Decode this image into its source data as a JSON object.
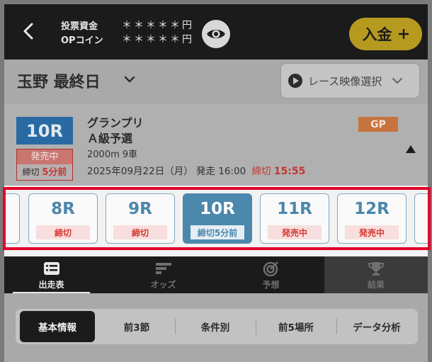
{
  "header": {
    "balance": [
      {
        "label": "投票資金",
        "value": "＊＊＊＊＊円"
      },
      {
        "label": "OPコイン",
        "value": "＊＊＊＊＊円"
      }
    ],
    "deposit_label": "入金",
    "deposit_icon": "plus-icon"
  },
  "venue": {
    "title": "玉野 最終日",
    "video_label": "レース映像選択"
  },
  "race": {
    "number": "10R",
    "name_line1": "グランプリ",
    "name_line2": "Ａ級予選",
    "meta": "2000m 9車",
    "status": "発売中",
    "deadline_status": "締切",
    "deadline_remaining": "5分前",
    "date": "2025年09月22日（月） 発走 16:00",
    "deadline_label": "締切",
    "deadline_time": "15:55",
    "grade": "GP"
  },
  "race_strip": [
    {
      "num": "8R",
      "status": "締切"
    },
    {
      "num": "9R",
      "status": "締切"
    },
    {
      "num": "10R",
      "status": "締切5分前"
    },
    {
      "num": "11R",
      "status": "発売中"
    },
    {
      "num": "12R",
      "status": "発売中"
    }
  ],
  "tabs": [
    {
      "label": "出走表",
      "icon": "list-icon"
    },
    {
      "label": "オッズ",
      "icon": "bar-chart-icon"
    },
    {
      "label": "予想",
      "icon": "target-icon"
    },
    {
      "label": "結果",
      "icon": "trophy-icon"
    }
  ],
  "subtabs": [
    "基本情報",
    "前3節",
    "条件別",
    "前5場所",
    "データ分析"
  ],
  "colors": {
    "accent": "#4c87ac",
    "highlight": "#e4002b",
    "deposit": "#b69a20",
    "sale": "#d43b32"
  }
}
